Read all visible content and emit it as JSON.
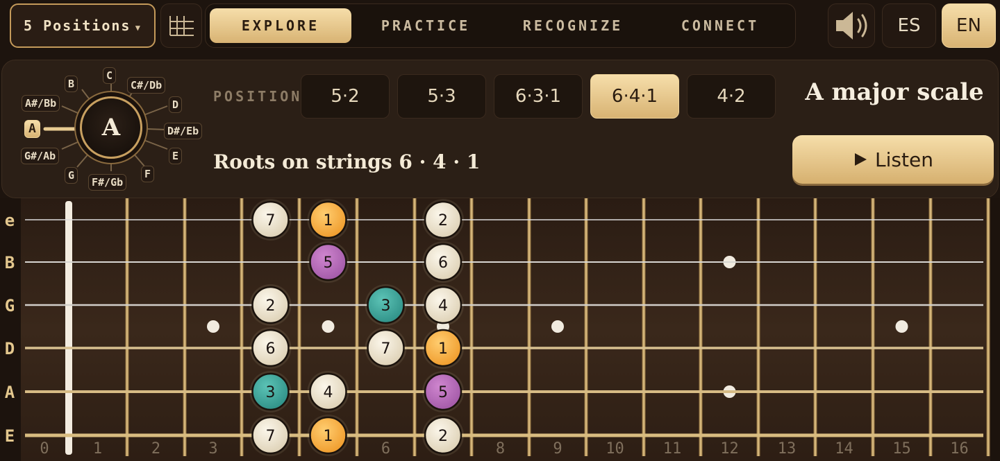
{
  "header": {
    "positions_select": "5 Positions",
    "tabs": [
      {
        "label": "EXPLORE",
        "active": true
      },
      {
        "label": "PRACTICE",
        "active": false
      },
      {
        "label": "RECOGNIZE",
        "active": false
      },
      {
        "label": "CONNECT",
        "active": false
      }
    ],
    "languages": [
      {
        "label": "ES",
        "active": false
      },
      {
        "label": "EN",
        "active": true
      }
    ]
  },
  "panel": {
    "note_wheel": {
      "selected": "A",
      "notes": [
        "C",
        "C#/Db",
        "D",
        "D#/Eb",
        "E",
        "F",
        "F#/Gb",
        "G",
        "G#/Ab",
        "A",
        "A#/Bb",
        "B"
      ]
    },
    "position_label": "POSITION",
    "positions": [
      {
        "label": "5·2",
        "active": false
      },
      {
        "label": "5·3",
        "active": false
      },
      {
        "label": "6·3·1",
        "active": false
      },
      {
        "label": "6·4·1",
        "active": true
      },
      {
        "label": "4·2",
        "active": false
      }
    ],
    "scale_title": "A major scale",
    "roots_text": "Roots on strings 6 · 4 · 1",
    "listen_label": "Listen"
  },
  "fretboard": {
    "string_labels": [
      "e",
      "B",
      "G",
      "D",
      "A",
      "E"
    ],
    "fret_numbers": [
      "0",
      "1",
      "2",
      "3",
      "4",
      "5",
      "6",
      "7",
      "8",
      "9",
      "10",
      "11",
      "12",
      "13",
      "14",
      "15",
      "16"
    ],
    "single_dots": [
      3,
      5,
      7,
      9,
      15
    ],
    "double_dots": [
      12
    ],
    "notes": [
      {
        "string": 0,
        "fret": 4,
        "degree": "7"
      },
      {
        "string": 0,
        "fret": 5,
        "degree": "1"
      },
      {
        "string": 0,
        "fret": 7,
        "degree": "2"
      },
      {
        "string": 1,
        "fret": 5,
        "degree": "5"
      },
      {
        "string": 1,
        "fret": 7,
        "degree": "6"
      },
      {
        "string": 2,
        "fret": 4,
        "degree": "2"
      },
      {
        "string": 2,
        "fret": 6,
        "degree": "3"
      },
      {
        "string": 2,
        "fret": 7,
        "degree": "4"
      },
      {
        "string": 3,
        "fret": 4,
        "degree": "6"
      },
      {
        "string": 3,
        "fret": 6,
        "degree": "7"
      },
      {
        "string": 3,
        "fret": 7,
        "degree": "1"
      },
      {
        "string": 4,
        "fret": 4,
        "degree": "3"
      },
      {
        "string": 4,
        "fret": 5,
        "degree": "4"
      },
      {
        "string": 4,
        "fret": 7,
        "degree": "5"
      },
      {
        "string": 5,
        "fret": 4,
        "degree": "7"
      },
      {
        "string": 5,
        "fret": 5,
        "degree": "1"
      },
      {
        "string": 5,
        "fret": 7,
        "degree": "2"
      }
    ],
    "colors": {
      "root": "#f5a93a",
      "third": "#3aa59a",
      "fifth": "#b567b8",
      "other": "#efe6d2"
    }
  }
}
